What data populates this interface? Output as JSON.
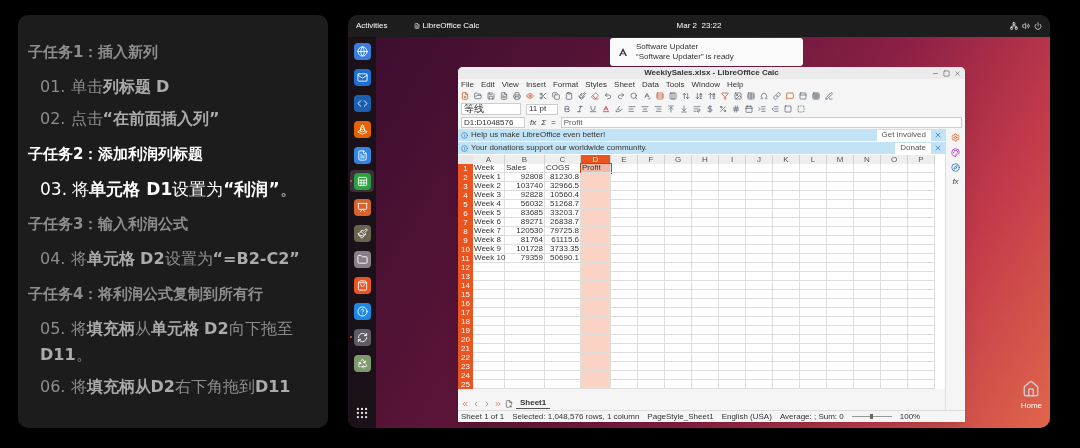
{
  "instructions": {
    "sections": [
      {
        "title": "子任务1：插入新列",
        "selected": false,
        "steps": [
          {
            "text": "01. 单击**列标题 D**",
            "selected": false
          },
          {
            "text": "02. 点击**“在前面插入列”**",
            "selected": false
          }
        ]
      },
      {
        "title": "子任务2：添加利润列标题",
        "selected": true,
        "steps": [
          {
            "text": "03. 将**单元格 D1**设置为**“利润”**。",
            "selected": true
          }
        ]
      },
      {
        "title": "子任务3：输入利润公式",
        "selected": false,
        "steps": [
          {
            "text": "04. 将**单元格 D2**设置为**“=B2-C2”**",
            "selected": false
          }
        ]
      },
      {
        "title": "子任务4：将利润公式复制到所有行",
        "selected": false,
        "steps": [
          {
            "text": "05. 将**填充柄**从**单元格 D2**向下拖至**D11**。",
            "selected": false
          },
          {
            "text": "06. 将**填充柄从D2**右下角拖到**D11**",
            "selected": false
          }
        ]
      }
    ]
  },
  "desktop": {
    "top_bar": {
      "activities": "Activities",
      "app_menu": "LibreOffice Calc",
      "clock": "Mar 2  23:22"
    },
    "dock": [
      {
        "kind": "browser",
        "running": false,
        "selected": false
      },
      {
        "kind": "mail",
        "running": false,
        "selected": false
      },
      {
        "kind": "code",
        "running": false,
        "selected": false
      },
      {
        "kind": "cone",
        "running": false,
        "selected": false
      },
      {
        "kind": "writer",
        "running": false,
        "selected": false
      },
      {
        "kind": "calc",
        "running": true,
        "selected": true
      },
      {
        "kind": "impress",
        "running": false,
        "selected": false
      },
      {
        "kind": "paint",
        "running": false,
        "selected": false
      },
      {
        "kind": "folder",
        "running": false,
        "selected": false
      },
      {
        "kind": "store",
        "running": false,
        "selected": false
      },
      {
        "kind": "help",
        "running": false,
        "selected": false
      },
      {
        "kind": "updater",
        "running": true,
        "selected": false
      },
      {
        "kind": "trash",
        "running": false,
        "selected": false
      }
    ],
    "notification": {
      "title": "Software Updater",
      "body": "“Software Updater” is ready"
    },
    "home_icon": {
      "label": "Home"
    },
    "calc_window": {
      "title": "WeeklySales.xlsx - LibreOffice Calc",
      "menu": [
        "File",
        "Edit",
        "View",
        "Insert",
        "Format",
        "Styles",
        "Sheet",
        "Data",
        "Tools",
        "Window",
        "Help"
      ],
      "font_name": "等线",
      "font_size": "11 pt",
      "deck_function": "fx",
      "formula_bar": {
        "name_box": "D1:D1048576",
        "symbols": [
          "fx",
          "Σ",
          "="
        ],
        "content": "Profit"
      },
      "infobars": [
        {
          "text": "Help us make LibreOffice even better!",
          "button": "Get involved"
        },
        {
          "text": "Your donations support our worldwide community.",
          "button": "Donate"
        }
      ],
      "columns": [
        {
          "label": "A",
          "selected": false
        },
        {
          "label": "B",
          "selected": false
        },
        {
          "label": "C",
          "selected": false
        },
        {
          "label": "D",
          "selected": true
        },
        {
          "label": "E",
          "selected": false
        },
        {
          "label": "F",
          "selected": false
        },
        {
          "label": "G",
          "selected": false
        },
        {
          "label": "H",
          "selected": false
        },
        {
          "label": "I",
          "selected": false
        },
        {
          "label": "J",
          "selected": false
        },
        {
          "label": "K",
          "selected": false
        },
        {
          "label": "L",
          "selected": false
        },
        {
          "label": "M",
          "selected": false
        },
        {
          "label": "N",
          "selected": false
        },
        {
          "label": "O",
          "selected": false
        },
        {
          "label": "P",
          "selected": false
        }
      ],
      "rows": [
        {
          "number": "1",
          "kind": "header",
          "cells": [
            "Week",
            "Sales",
            "COGS",
            "Profit"
          ]
        },
        {
          "number": "2",
          "kind": "data",
          "cells": [
            "Week 1",
            "92808",
            "81230.8"
          ]
        },
        {
          "number": "3",
          "kind": "data",
          "cells": [
            "Week 2",
            "103740",
            "32966.5"
          ]
        },
        {
          "number": "4",
          "kind": "data",
          "cells": [
            "Week 3",
            "92828",
            "10560.4"
          ]
        },
        {
          "number": "5",
          "kind": "data",
          "cells": [
            "Week 4",
            "56032",
            "51268.7"
          ]
        },
        {
          "number": "6",
          "kind": "data",
          "cells": [
            "Week 5",
            "83685",
            "33203.7"
          ]
        },
        {
          "number": "7",
          "kind": "data",
          "cells": [
            "Week 6",
            "89271",
            "26838.7"
          ]
        },
        {
          "number": "8",
          "kind": "data",
          "cells": [
            "Week 7",
            "120530",
            "79725.8"
          ]
        },
        {
          "number": "9",
          "kind": "data",
          "cells": [
            "Week 8",
            "81764",
            "61115.6"
          ]
        },
        {
          "number": "10",
          "kind": "data",
          "cells": [
            "Week 9",
            "101728",
            "3733.35"
          ]
        },
        {
          "number": "11",
          "kind": "data",
          "cells": [
            "Week 10",
            "79359",
            "50690.1"
          ]
        },
        {
          "number": "12",
          "kind": "empty",
          "cells": []
        },
        {
          "number": "13",
          "kind": "empty",
          "cells": []
        },
        {
          "number": "14",
          "kind": "empty",
          "cells": []
        },
        {
          "number": "15",
          "kind": "empty",
          "cells": []
        },
        {
          "number": "16",
          "kind": "empty",
          "cells": []
        },
        {
          "number": "17",
          "kind": "empty",
          "cells": []
        },
        {
          "number": "18",
          "kind": "empty",
          "cells": []
        },
        {
          "number": "19",
          "kind": "empty",
          "cells": []
        },
        {
          "number": "20",
          "kind": "empty",
          "cells": []
        },
        {
          "number": "21",
          "kind": "empty",
          "cells": []
        },
        {
          "number": "22",
          "kind": "empty",
          "cells": []
        },
        {
          "number": "23",
          "kind": "empty",
          "cells": []
        },
        {
          "number": "24",
          "kind": "empty",
          "cells": []
        },
        {
          "number": "25",
          "kind": "empty",
          "cells": []
        }
      ],
      "sheet_tabs": [
        {
          "label": "Sheet1",
          "selected": true
        }
      ],
      "status_bar": {
        "items": [
          "Sheet 1 of 1",
          "Selected: 1,048,576 rows, 1 column",
          "PageStyle_Sheet1",
          "English (USA)",
          "Average: ; Sum: 0"
        ],
        "zoom": {
          "level": 0.5,
          "reading": "100%"
        }
      }
    }
  }
}
